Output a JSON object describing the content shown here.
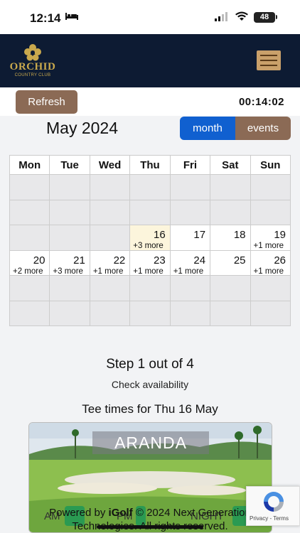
{
  "status_bar": {
    "time": "12:14",
    "battery": "48"
  },
  "header": {
    "logo_text": "ORCHID",
    "logo_subtext": "COUNTRY CLUB"
  },
  "toolbar": {
    "refresh_label": "Refresh",
    "timer": "00:14:02"
  },
  "calendar": {
    "title": "May 2024",
    "view_month": "month",
    "view_events": "events",
    "weekdays": [
      "Mon",
      "Tue",
      "Wed",
      "Thu",
      "Fri",
      "Sat",
      "Sun"
    ],
    "weeks": [
      [
        {
          "day": "",
          "more": ""
        },
        {
          "day": "",
          "more": ""
        },
        {
          "day": "",
          "more": ""
        },
        {
          "day": "",
          "more": ""
        },
        {
          "day": "",
          "more": ""
        },
        {
          "day": "",
          "more": ""
        },
        {
          "day": "",
          "more": ""
        }
      ],
      [
        {
          "day": "",
          "more": ""
        },
        {
          "day": "",
          "more": ""
        },
        {
          "day": "",
          "more": ""
        },
        {
          "day": "",
          "more": ""
        },
        {
          "day": "",
          "more": ""
        },
        {
          "day": "",
          "more": ""
        },
        {
          "day": "",
          "more": ""
        }
      ],
      [
        {
          "day": "",
          "more": ""
        },
        {
          "day": "",
          "more": ""
        },
        {
          "day": "",
          "more": ""
        },
        {
          "day": "16",
          "more": "+3 more",
          "today": true
        },
        {
          "day": "17",
          "more": ""
        },
        {
          "day": "18",
          "more": ""
        },
        {
          "day": "19",
          "more": "+1 more"
        }
      ],
      [
        {
          "day": "20",
          "more": "+2 more"
        },
        {
          "day": "21",
          "more": "+3 more"
        },
        {
          "day": "22",
          "more": "+1 more"
        },
        {
          "day": "23",
          "more": "+1 more"
        },
        {
          "day": "24",
          "more": "+1 more"
        },
        {
          "day": "25",
          "more": ""
        },
        {
          "day": "26",
          "more": "+1 more"
        }
      ],
      [
        {
          "day": "",
          "more": ""
        },
        {
          "day": "",
          "more": ""
        },
        {
          "day": "",
          "more": ""
        },
        {
          "day": "",
          "more": ""
        },
        {
          "day": "",
          "more": ""
        },
        {
          "day": "",
          "more": ""
        },
        {
          "day": "",
          "more": ""
        }
      ],
      [
        {
          "day": "",
          "more": ""
        },
        {
          "day": "",
          "more": ""
        },
        {
          "day": "",
          "more": ""
        },
        {
          "day": "",
          "more": ""
        },
        {
          "day": "",
          "more": ""
        },
        {
          "day": "",
          "more": ""
        },
        {
          "day": "",
          "more": ""
        }
      ]
    ]
  },
  "steps": {
    "title": "Step 1 out of 4",
    "subtitle": "Check availability"
  },
  "tee_times": {
    "title": "Tee times for Thu 16 May",
    "course": "ARANDA",
    "slots": [
      "AM",
      "PM",
      "NIGHT"
    ]
  },
  "footer": {
    "prefix": "Powered by ",
    "brand": "iGolf",
    "rest": " © 2024 Next Generation",
    "line2": "Technologies. All rights reserved."
  },
  "recaptcha": {
    "text": "Privacy - Terms"
  },
  "colors": {
    "navy": "#0d1b33",
    "gold": "#c9a94d",
    "brown": "#8b6a55",
    "blue": "#1060d0",
    "green": "#2a9a52"
  }
}
